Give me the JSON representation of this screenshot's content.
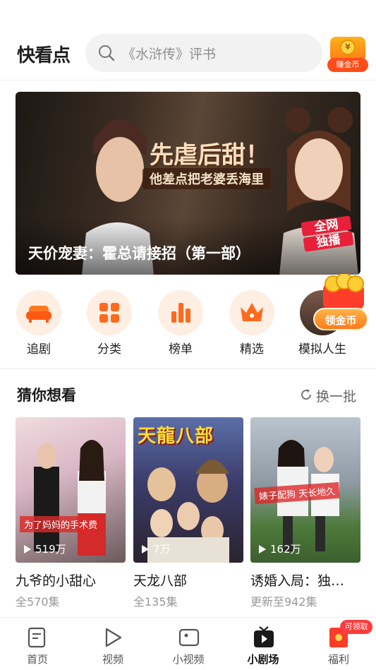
{
  "header": {
    "logo": "快看点",
    "search_placeholder": "《水浒传》评书",
    "coin_button_label": "赚金币",
    "coin_symbol": "¥"
  },
  "banner": {
    "slogan": "先虐后甜！",
    "sub_slogan": "他差点把老婆丢海里",
    "title": "天价宠妻：霍总请接招（第一部）",
    "badge_line1": "全网",
    "badge_line2": "独播"
  },
  "categories": [
    {
      "label": "追剧",
      "icon": "sofa-icon"
    },
    {
      "label": "分类",
      "icon": "grid-icon"
    },
    {
      "label": "榜单",
      "icon": "bar-chart-icon"
    },
    {
      "label": "精选",
      "icon": "crown-icon"
    },
    {
      "label": "模拟人生",
      "icon": "avatar-icon"
    }
  ],
  "floating_reward": {
    "label": "领金币"
  },
  "section": {
    "title": "猜你想看",
    "refresh_label": "换一批"
  },
  "cards": [
    {
      "plays": "519万",
      "name": "九爷的小甜心",
      "sub": "全570集",
      "caption": "为了妈妈的手术费"
    },
    {
      "plays": "7万",
      "name": "天龙八部",
      "sub": "全135集",
      "poster_title": "天龍八部"
    },
    {
      "plays": "162万",
      "name": "诱婚入局：独…",
      "sub": "更新至942集",
      "caption": "婊子配狗 天长地久"
    }
  ],
  "nav": {
    "items": [
      {
        "label": "首页",
        "icon": "home-doc-icon"
      },
      {
        "label": "视频",
        "icon": "play-icon"
      },
      {
        "label": "小视频",
        "icon": "small-video-icon"
      },
      {
        "label": "小剧场",
        "icon": "theater-icon",
        "active": true
      },
      {
        "label": "福利",
        "icon": "red-envelope-icon"
      }
    ],
    "badge": "可领取"
  },
  "colors": {
    "accent": "#ff6a1f",
    "badge_red": "#ff3b3b"
  }
}
